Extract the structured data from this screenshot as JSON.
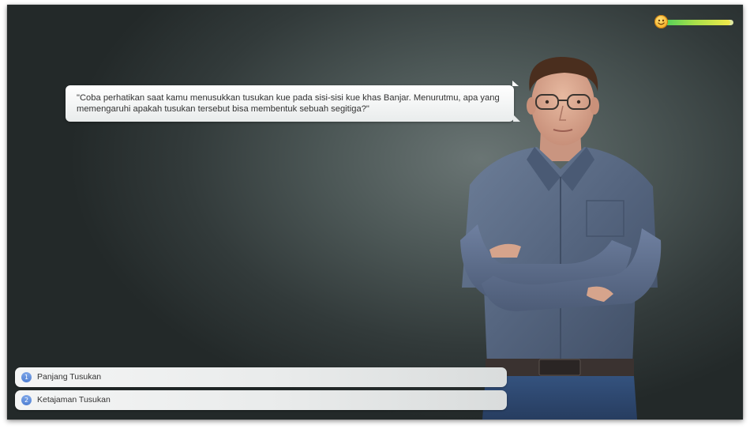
{
  "meter": {
    "icon": "smiley-face-icon",
    "progress": 0.95,
    "colors": {
      "start": "#53d05a",
      "end": "#f1e94a"
    }
  },
  "dialogue": {
    "text": "\"Coba perhatikan saat kamu menusukkan tusukan kue pada sisi-sisi kue khas Banjar. Menurutmu, apa yang memengaruhi apakah tusukan tersebut bisa membentuk sebuah segitiga?\""
  },
  "character": {
    "icon": "presenter-man-crossed-arms"
  },
  "options": [
    {
      "number": "1",
      "label": "Panjang Tusukan"
    },
    {
      "number": "2",
      "label": "Ketajaman Tusukan"
    }
  ],
  "colors": {
    "accent": "#4f7fd3",
    "background": "#3b4444"
  }
}
